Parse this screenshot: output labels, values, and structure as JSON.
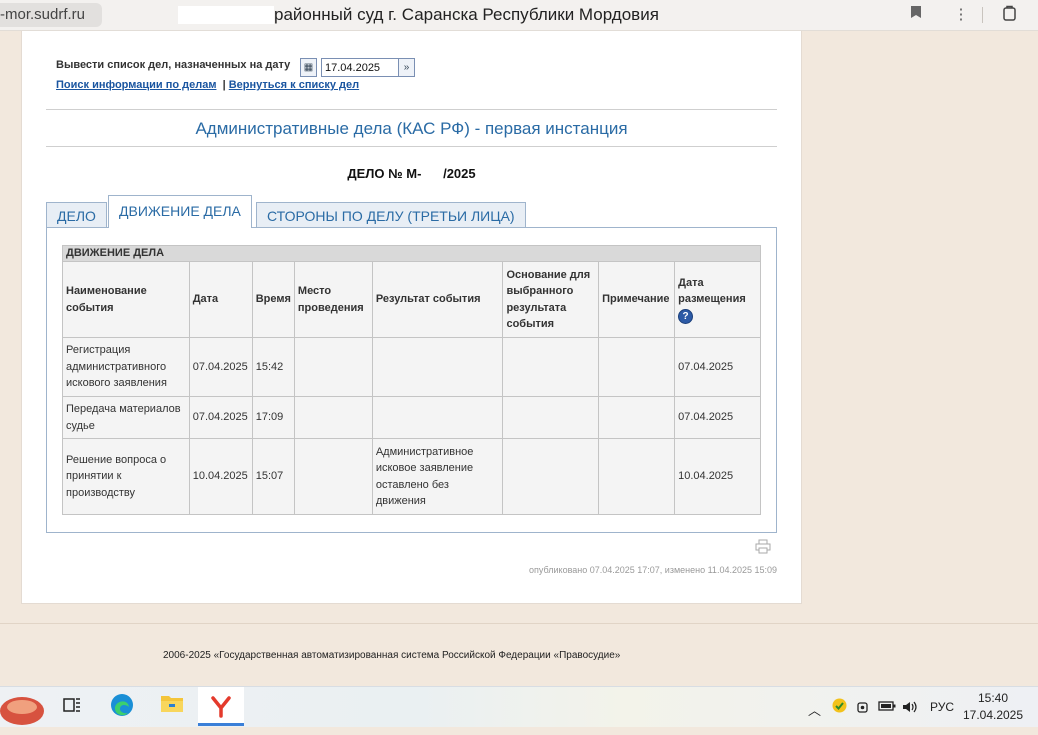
{
  "browser": {
    "url_fragment": "-mor.sudrf.ru",
    "page_title": "районный суд г. Саранска Республики Мордовия"
  },
  "filter": {
    "label": "Вывести список дел, назначенных на дату",
    "date_value": "17.04.2025",
    "search_link": "Поиск информации по делам",
    "separator": "|",
    "back_link": "Вернуться к списку дел"
  },
  "section_title": "Административные дела (КАС РФ) - первая инстанция",
  "case_number": "ДЕЛО № М-      /2025",
  "tabs": [
    {
      "label": "ДЕЛО"
    },
    {
      "label": "ДВИЖЕНИЕ ДЕЛА"
    },
    {
      "label": "СТОРОНЫ ПО ДЕЛУ (ТРЕТЬИ ЛИЦА)"
    }
  ],
  "movement": {
    "caption": "ДВИЖЕНИЕ ДЕЛА",
    "headers": [
      "Наименование события",
      "Дата",
      "Время",
      "Место проведения",
      "Результат события",
      "Основание для выбранного результата события",
      "Примечание",
      "Дата размещения"
    ],
    "rows": [
      [
        "Регистрация административного искового заявления",
        "07.04.2025",
        "15:42",
        "",
        "",
        "",
        "",
        "07.04.2025"
      ],
      [
        "Передача материалов судье",
        "07.04.2025",
        "17:09",
        "",
        "",
        "",
        "",
        "07.04.2025"
      ],
      [
        "Решение вопроса о принятии к производству",
        "10.04.2025",
        "15:07",
        "",
        "Административное исковое заявление оставлено без движения",
        "",
        "",
        "10.04.2025"
      ]
    ]
  },
  "published": "опубликовано 07.04.2025 17:07, изменено 11.04.2025 15:09",
  "footer": "2006-2025 «Государственная автоматизированная система Российской Федерации «Правосудие»",
  "taskbar": {
    "lang": "РУС",
    "time": "15:40",
    "date": "17.04.2025"
  },
  "colors": {
    "link": "#1a55a0",
    "accent": "#2a6ba5",
    "page_bg": "#f2e8dd"
  }
}
